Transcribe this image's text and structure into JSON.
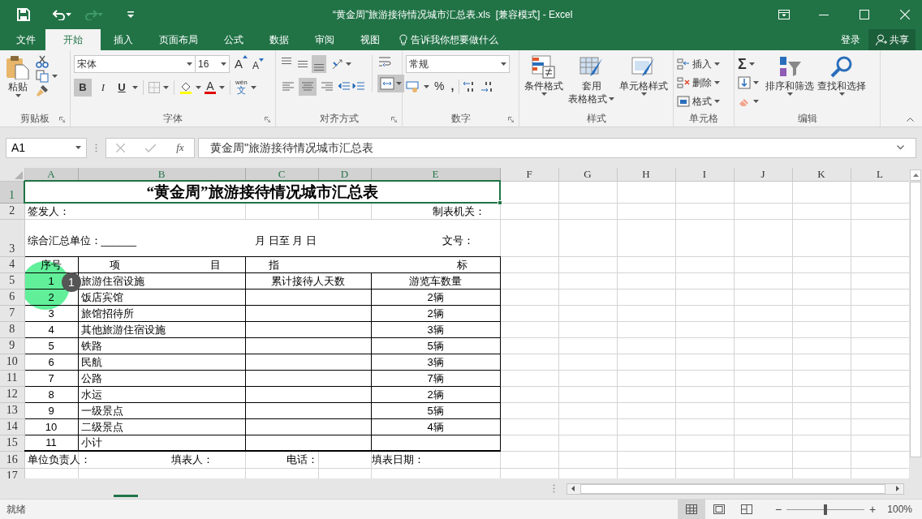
{
  "title_bar": {
    "title": "“黄金周”旅游接待情况城市汇总表.xls  [兼容模式] - Excel"
  },
  "menu_tabs": [
    {
      "label": "文件",
      "selected": false
    },
    {
      "label": "开始",
      "selected": true
    },
    {
      "label": "插入",
      "selected": false
    },
    {
      "label": "页面布局",
      "selected": false
    },
    {
      "label": "公式",
      "selected": false
    },
    {
      "label": "数据",
      "selected": false
    },
    {
      "label": "审阅",
      "selected": false
    },
    {
      "label": "视图",
      "selected": false
    }
  ],
  "tell_me": {
    "placeholder": "告诉我你想要做什么"
  },
  "sign_in": "登录",
  "share": "共享",
  "ribbon": {
    "clipboard": {
      "paste": "粘贴",
      "label": "剪贴板"
    },
    "font": {
      "font_name": "宋体",
      "font_size": "16",
      "grow_font": "A",
      "shrink_font": "A",
      "bold": "B",
      "italic": "I",
      "underline": "U",
      "font_color": "A",
      "phonetic": [
        "wén",
        "文"
      ],
      "label": "字体"
    },
    "alignment": {
      "vertical_align": [
        {
          "kind": "top",
          "selected": false
        },
        {
          "kind": "middle",
          "selected": false
        },
        {
          "kind": "bottom",
          "selected": true
        }
      ],
      "horizontal_align": [
        {
          "kind": "left",
          "selected": false
        },
        {
          "kind": "center",
          "selected": true
        },
        {
          "kind": "right",
          "selected": false
        }
      ],
      "merge_center": {
        "selected": true
      },
      "label": "对齐方式"
    },
    "number": {
      "format": "常规",
      "percent": "%",
      "comma": ",",
      "label": "数字"
    },
    "styles": {
      "conditional": "条件格式",
      "table_format": [
        "套用",
        "表格格式"
      ],
      "cell_styles": "单元格样式",
      "label": "样式"
    },
    "cells": {
      "buttons": [
        "插入",
        "删除",
        "格式"
      ],
      "label": "单元格"
    },
    "editing": {
      "sum": "Σ",
      "sort_filter": "排序和筛选",
      "find_select": "查找和选择",
      "label": "编辑"
    }
  },
  "formula_bar": {
    "name_box": "A1",
    "fx": "fx",
    "formula": "黄金周\"旅游接待情况城市汇总表"
  },
  "sheet": {
    "columns": [
      {
        "label": "A",
        "selected": true
      },
      {
        "label": "B",
        "selected": true
      },
      {
        "label": "C",
        "selected": true
      },
      {
        "label": "D",
        "selected": true
      },
      {
        "label": "E",
        "selected": true
      },
      {
        "label": "F",
        "selected": false
      },
      {
        "label": "G",
        "selected": false
      },
      {
        "label": "H",
        "selected": false
      },
      {
        "label": "I",
        "selected": false
      },
      {
        "label": "J",
        "selected": false
      },
      {
        "label": "K",
        "selected": false
      },
      {
        "label": "L",
        "selected": false
      }
    ],
    "row_numbers": [
      {
        "label": "1",
        "selected": true
      },
      {
        "label": "2",
        "selected": false
      },
      {
        "label": "3",
        "selected": false
      },
      {
        "label": "4",
        "selected": false
      },
      {
        "label": "5",
        "selected": false
      },
      {
        "label": "6",
        "selected": false
      },
      {
        "label": "7",
        "selected": false
      },
      {
        "label": "8",
        "selected": false
      },
      {
        "label": "9",
        "selected": false
      },
      {
        "label": "10",
        "selected": false
      },
      {
        "label": "11",
        "selected": false
      },
      {
        "label": "12",
        "selected": false
      },
      {
        "label": "13",
        "selected": false
      },
      {
        "label": "14",
        "selected": false
      },
      {
        "label": "15",
        "selected": false
      },
      {
        "label": "16",
        "selected": false
      },
      {
        "label": "17",
        "selected": false
      }
    ],
    "form": {
      "title": "“黄金周”旅游接待情况城市汇总表",
      "issuer_label": "签发人：",
      "authority_label": "制表机关：",
      "unit_label": "综合汇总单位：______",
      "period": "月  日至  月  日",
      "doc_no_label": "文号：",
      "header": {
        "no": "序号",
        "item_left": "项",
        "item_right": "目",
        "index_left": "指",
        "index_right": "标"
      },
      "rows": [
        {
          "no": "1",
          "item": "旅游住宿设施",
          "days": "累计接待人天数",
          "vehicles": "游览车数量"
        },
        {
          "no": "2",
          "item": "饭店宾馆",
          "vehicles": "2辆"
        },
        {
          "no": "3",
          "item": "旅馆招待所",
          "vehicles": "2辆"
        },
        {
          "no": "4",
          "item": "其他旅游住宿设施",
          "vehicles": "3辆"
        },
        {
          "no": "5",
          "item": "铁路",
          "vehicles": "5辆"
        },
        {
          "no": "6",
          "item": "民航",
          "vehicles": "3辆"
        },
        {
          "no": "7",
          "item": "公路",
          "vehicles": "7辆"
        },
        {
          "no": "8",
          "item": "水运",
          "vehicles": "2辆"
        },
        {
          "no": "9",
          "item": "一级景点",
          "vehicles": "5辆"
        },
        {
          "no": "10",
          "item": "二级景点",
          "vehicles": "4辆"
        },
        {
          "no": "11",
          "item": "小计"
        }
      ],
      "footer": [
        "单位负责人：",
        "填表人：",
        "电话：",
        "填表日期："
      ]
    }
  },
  "click_marker": {
    "step": "1"
  },
  "status_bar": {
    "ready": "就绪",
    "views": [
      {
        "kind": "normal",
        "selected": true
      },
      {
        "kind": "page_layout",
        "selected": false
      },
      {
        "kind": "page_break",
        "selected": false
      }
    ],
    "zoom_out": "−",
    "zoom_in": "+",
    "zoom_slider": {
      "level": 0.5
    },
    "zoom": "100%"
  }
}
